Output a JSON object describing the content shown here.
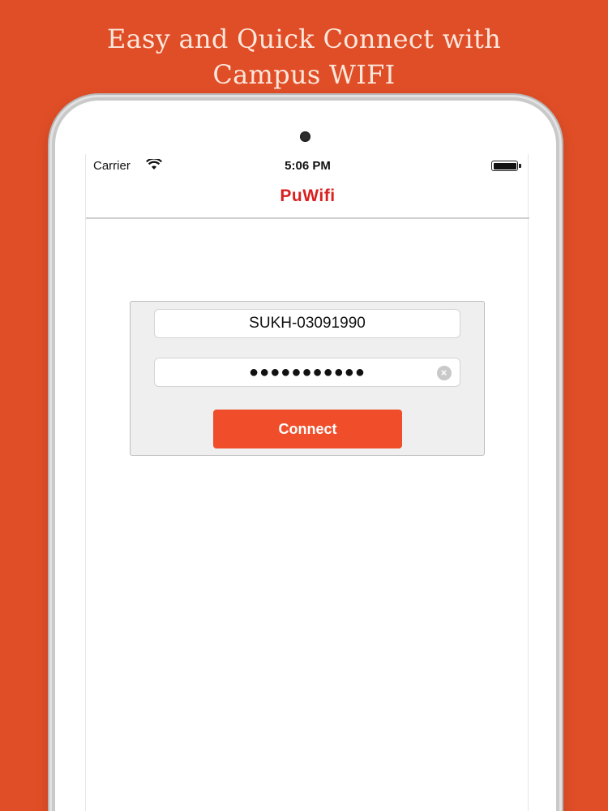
{
  "banner": {
    "line1": "Easy and Quick Connect with",
    "line2": "Campus WIFI"
  },
  "status_bar": {
    "carrier": "Carrier",
    "time": "5:06 PM",
    "wifi_icon": "wifi-icon",
    "battery_icon": "battery-icon"
  },
  "nav": {
    "title": "PuWifi"
  },
  "login": {
    "username_value": "SUKH-03091990",
    "password_value": "●●●●●●●●●●●",
    "clear_icon": "clear-icon",
    "connect_label": "Connect"
  },
  "colors": {
    "background": "#e04e27",
    "accent": "#f04e2a",
    "title_red": "#d91f1f"
  }
}
